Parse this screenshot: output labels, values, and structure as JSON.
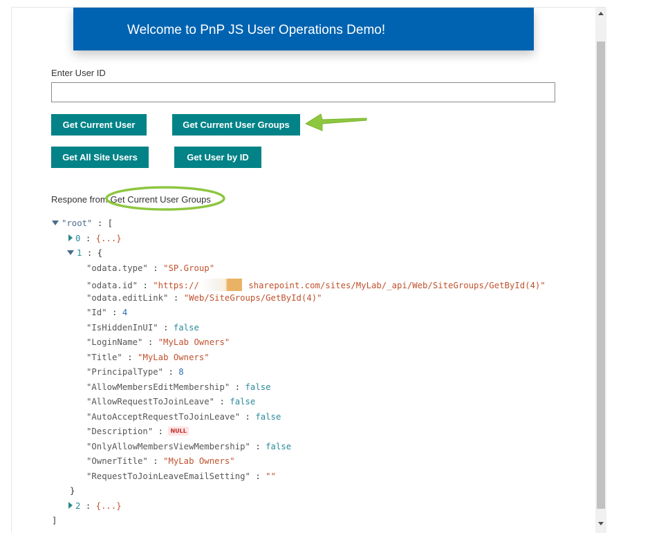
{
  "banner": {
    "title": "Welcome to PnP JS User Operations Demo!",
    "color": "#0063b1"
  },
  "form": {
    "user_id_label": "Enter User ID",
    "user_id_value": "",
    "user_id_placeholder": ""
  },
  "buttons": {
    "get_current_user": "Get Current User",
    "get_current_user_groups": "Get Current User Groups",
    "get_all_site_users": "Get All Site Users",
    "get_user_by_id": "Get User by ID",
    "color": "#038387"
  },
  "response": {
    "prefix": "Respone from",
    "operation": "Get Current User Groups"
  },
  "annotations": {
    "color": "#8dc63f",
    "arrow_icon": "green-arrow-icon",
    "ellipse_icon": "green-ellipse-icon"
  },
  "json_view": {
    "root_key": "\"root\"",
    "colon": ":",
    "open_bracket": "[",
    "close_bracket": "]",
    "open_brace": "{",
    "close_brace": "}",
    "collapsed": "{...}",
    "item0_index": "0",
    "item1_index": "1",
    "item2_index": "2",
    "props": [
      {
        "key": "\"odata.type\"",
        "value": "\"SP.Group\"",
        "type": "string"
      },
      {
        "key": "\"odata.id\"",
        "value_prefix": "\"https://",
        "value_suffix": "sharepoint.com/sites/MyLab/_api/Web/SiteGroups/GetById(4)\"",
        "type": "redacted-string"
      },
      {
        "key": "\"odata.editLink\"",
        "value": "\"Web/SiteGroups/GetById(4)\"",
        "type": "string"
      },
      {
        "key": "\"Id\"",
        "value": "4",
        "type": "number"
      },
      {
        "key": "\"IsHiddenInUI\"",
        "value": "false",
        "type": "boolean"
      },
      {
        "key": "\"LoginName\"",
        "value": "\"MyLab Owners\"",
        "type": "string"
      },
      {
        "key": "\"Title\"",
        "value": "\"MyLab Owners\"",
        "type": "string"
      },
      {
        "key": "\"PrincipalType\"",
        "value": "8",
        "type": "number"
      },
      {
        "key": "\"AllowMembersEditMembership\"",
        "value": "false",
        "type": "boolean"
      },
      {
        "key": "\"AllowRequestToJoinLeave\"",
        "value": "false",
        "type": "boolean"
      },
      {
        "key": "\"AutoAcceptRequestToJoinLeave\"",
        "value": "false",
        "type": "boolean"
      },
      {
        "key": "\"Description\"",
        "value": "NULL",
        "type": "null"
      },
      {
        "key": "\"OnlyAllowMembersViewMembership\"",
        "value": "false",
        "type": "boolean"
      },
      {
        "key": "\"OwnerTitle\"",
        "value": "\"MyLab Owners\"",
        "type": "string"
      },
      {
        "key": "\"RequestToJoinLeaveEmailSetting\"",
        "value": "\"\"",
        "type": "string"
      }
    ]
  }
}
